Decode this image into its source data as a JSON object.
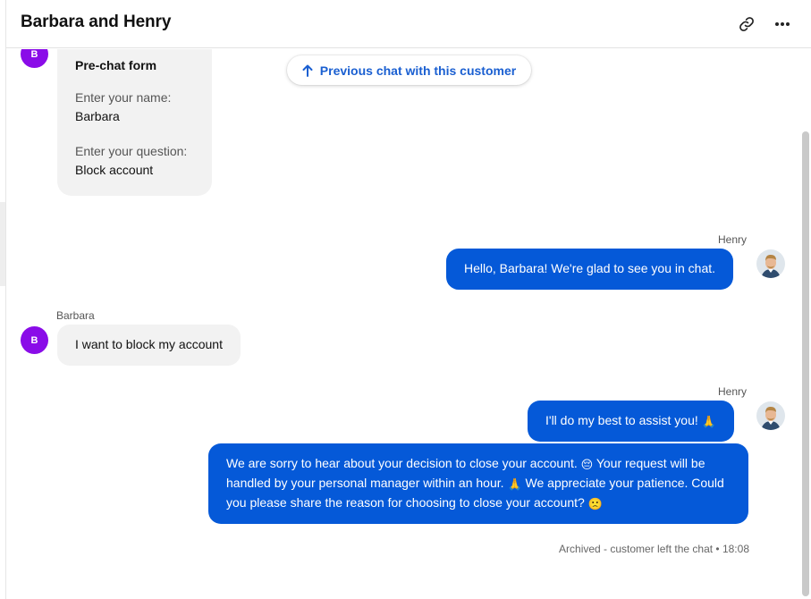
{
  "header": {
    "title": "Barbara and Henry",
    "link_icon": "link-icon",
    "more_icon": "more-horizontal-icon"
  },
  "prechat": {
    "avatar_initial": "B",
    "title": "Pre-chat form",
    "fields": [
      {
        "label": "Enter your name:",
        "value": "Barbara"
      },
      {
        "label": "Enter your question:",
        "value": "Block account"
      }
    ]
  },
  "previous_chat": {
    "label": "Previous chat with this customer",
    "icon": "arrow-up-icon"
  },
  "messages": [
    {
      "sender": "Henry",
      "role": "agent",
      "text": "Hello, Barbara! We're glad to see you in chat."
    },
    {
      "sender": "Barbara",
      "role": "customer",
      "avatar_initial": "B",
      "text": "I want to block my account"
    },
    {
      "sender": "Henry",
      "role": "agent",
      "text": "I'll do my best to assist you!",
      "emoji": "🙏"
    },
    {
      "role": "agent",
      "text_parts": [
        "We are sorry to hear about your decision to close your account.",
        "😔",
        " Your request will be handled by your personal manager within an hour.",
        "🙏",
        " We appreciate your patience. Could you please share the reason for choosing to close your account?",
        "🙁"
      ]
    }
  ],
  "status": "Archived - customer left the chat • 18:08",
  "colors": {
    "agent_bubble": "#0559d8",
    "customer_bubble": "#f2f2f2",
    "customer_avatar": "#8a0ce8",
    "link_accent": "#1a5fd1"
  }
}
